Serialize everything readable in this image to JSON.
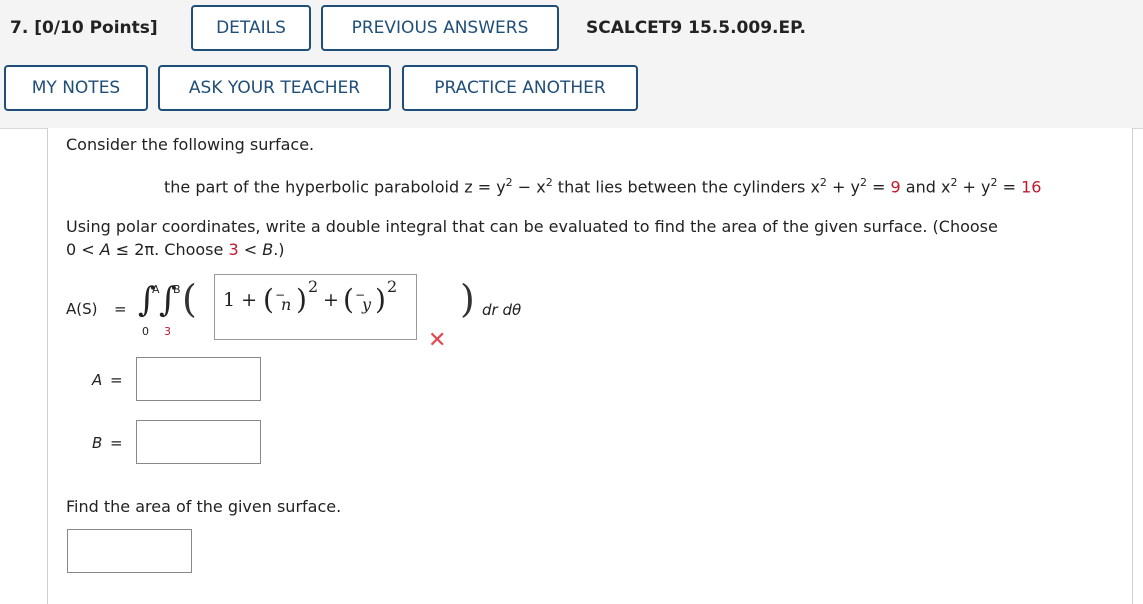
{
  "header": {
    "question_number": "7. [0/10 Points]",
    "details": "DETAILS",
    "previous_answers": "PREVIOUS ANSWERS",
    "reference": "SCALCET9 15.5.009.EP.",
    "my_notes": "MY NOTES",
    "ask_teacher": "ASK YOUR TEACHER",
    "practice_another": "PRACTICE ANOTHER"
  },
  "problem": {
    "intro": "Consider the following surface.",
    "surface_prefix": "the part of the hyperbolic paraboloid z = y",
    "surface_mid1": " − x",
    "surface_mid2": " that lies between the cylinders x",
    "surface_plus1": " + y",
    "surface_eq1": " = ",
    "surface_val1": "9",
    "surface_and": " and x",
    "surface_plus2": " + y",
    "surface_eq2": " = ",
    "surface_val2": "16",
    "exponent": "2",
    "instruction_line1": "Using polar coordinates, write a double integral that can be evaluated to find the area of the given surface. (Choose",
    "instruction_line2_a": "0 < ",
    "instruction_line2_A": "A",
    "instruction_line2_b": " ≤ 2π. Choose ",
    "instruction_line2_three": "3",
    "instruction_line2_c": " < ",
    "instruction_line2_B": "B",
    "instruction_line2_d": ".)",
    "integral_label": "A(S)",
    "equals": "=",
    "upper_outer": "A",
    "upper_inner": "B",
    "lower_outer": "0",
    "lower_inner": "3",
    "integrand_one_plus": "1 +",
    "integrand_plus": "+",
    "power": "2",
    "partial_sym": "−",
    "denominator_1": "n",
    "denominator_2": "y",
    "differentials": "dr dθ",
    "wrong_mark": "✕",
    "a_label": "A",
    "b_label": "B",
    "find_area": "Find the area of the given surface."
  },
  "colors": {
    "button_border": "#1f4e79",
    "red_value": "#c0182a",
    "wrong_mark": "#e0474c"
  }
}
